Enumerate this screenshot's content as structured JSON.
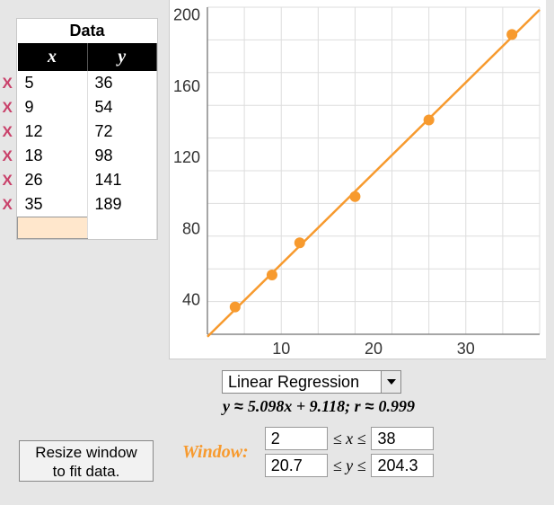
{
  "data_panel": {
    "title": "Data",
    "x_header": "x",
    "y_header": "y",
    "rows": [
      {
        "x": "5",
        "y": "36"
      },
      {
        "x": "9",
        "y": "54"
      },
      {
        "x": "12",
        "y": "72"
      },
      {
        "x": "18",
        "y": "98"
      },
      {
        "x": "26",
        "y": "141"
      },
      {
        "x": "35",
        "y": "189"
      }
    ],
    "delete_marker": "X"
  },
  "chart_data": {
    "type": "scatter",
    "title": "",
    "xlabel": "",
    "ylabel": "",
    "xlim": [
      2,
      38
    ],
    "ylim": [
      20.7,
      204.3
    ],
    "x_ticks": [
      10,
      20,
      30
    ],
    "y_ticks": [
      40,
      80,
      120,
      160,
      200
    ],
    "series": [
      {
        "name": "points",
        "x": [
          5,
          9,
          12,
          18,
          26,
          35
        ],
        "y": [
          36,
          54,
          72,
          98,
          141,
          189
        ]
      },
      {
        "name": "fit",
        "slope": 5.098,
        "intercept": 9.118,
        "r": 0.999
      }
    ],
    "grid": true,
    "point_color": "#f79a2e",
    "line_color": "#f79a2e"
  },
  "dropdown": {
    "selected": "Linear Regression"
  },
  "equation": {
    "text": "y ≈ 5.098x + 9.118; r ≈ 0.999",
    "y_part": "y",
    "approx1": " ≈ ",
    "mid": "5.098x + 9.118; r",
    "approx2": " ≈ ",
    "end": "0.999"
  },
  "window": {
    "label": "Window:",
    "xmin": "2",
    "xmax": "38",
    "ymin": "20.7",
    "ymax": "204.3",
    "x_expr": "≤ x ≤",
    "y_expr": "≤ y ≤"
  },
  "resize_button": {
    "line1": "Resize window",
    "line2": "to fit data."
  }
}
